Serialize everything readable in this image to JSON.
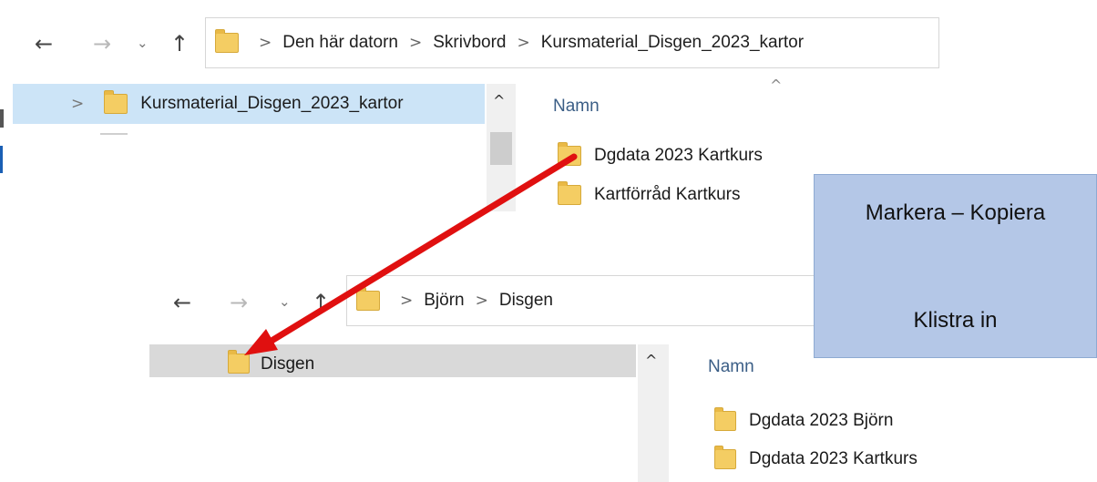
{
  "top_window": {
    "nav": {
      "back_glyph": "←",
      "forward_glyph": "→",
      "recent_glyph": "⌄",
      "up_glyph": "↑"
    },
    "breadcrumb": [
      "Den här datorn",
      "Skrivbord",
      "Kursmaterial_Disgen_2023_kartor"
    ],
    "breadcrumb_separator": ">",
    "tree": {
      "selected_item": "Kursmaterial_Disgen_2023_kartor",
      "expand_glyph": ">"
    },
    "column_header": "Namn",
    "files": [
      "Dgdata 2023 Kartkurs",
      "Kartförråd Kartkurs"
    ]
  },
  "bottom_window": {
    "nav": {
      "back_glyph": "←",
      "forward_glyph": "→",
      "recent_glyph": "⌄",
      "up_glyph": "↑"
    },
    "breadcrumb": [
      "Björn",
      "Disgen"
    ],
    "breadcrumb_separator": ">",
    "tree": {
      "selected_item": "Disgen"
    },
    "column_header": "Namn",
    "files": [
      "Dgdata 2023 Björn",
      "Dgdata 2023 Kartkurs"
    ]
  },
  "callout": {
    "line1": "Markera – Kopiera",
    "line2": "Klistra in"
  },
  "colors": {
    "arrow": "#e01010",
    "callout_fill": "#b4c7e7",
    "tree_selected": "#cce4f7",
    "tree_selected_bottom": "#d9d9d9",
    "folder": "#f4cd63",
    "column_header": "#3b5e86"
  },
  "icons": {
    "folder": "folder-icon",
    "arrow": "red-arrow-icon"
  }
}
